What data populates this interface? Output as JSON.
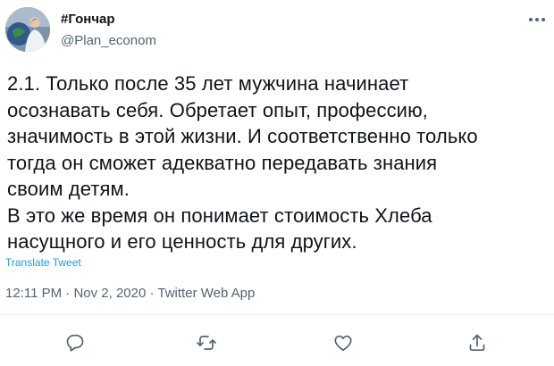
{
  "author": {
    "name": "#Гончар",
    "handle": "@Plan_econom"
  },
  "tweet": {
    "lines": [
      "2.1. Только после 35 лет мужчина начинает",
      "осознавать себя. Обретает опыт, профессию,",
      "значимость в этой жизни. И соответственно только",
      "тогда он сможет адекватно передавать знания",
      "своим детям.",
      "В это же время он понимает стоимость Хлеба",
      "насущного и его ценность для других."
    ],
    "translate_label": "Translate Tweet"
  },
  "meta": {
    "time": "12:11 PM",
    "separator": " · ",
    "date": "Nov 2, 2020",
    "source": "Twitter Web App"
  },
  "icons": {
    "more": "more-icon",
    "reply": "reply-icon",
    "retweet": "retweet-icon",
    "like": "like-icon",
    "share": "share-icon"
  },
  "colors": {
    "text": "#0f1419",
    "secondary": "#536471",
    "link": "#1d9bf0",
    "icon": "#536471"
  }
}
